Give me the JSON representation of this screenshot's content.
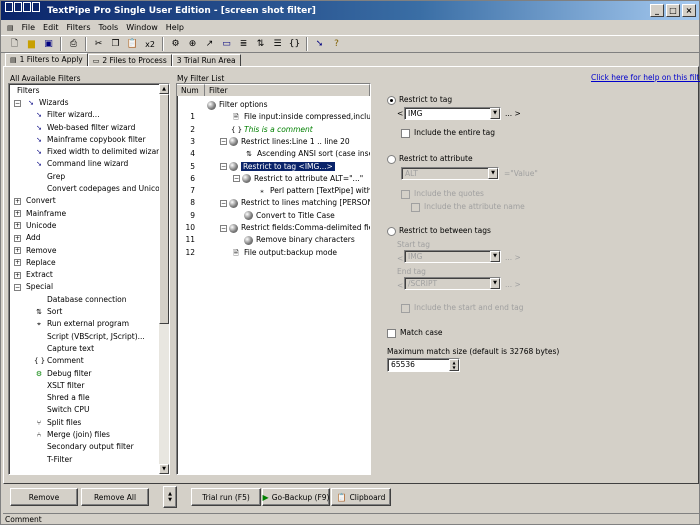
{
  "window": {
    "title": "TextPipe Pro Single User Edition - [screen shot filter]"
  },
  "menu": [
    "File",
    "Edit",
    "Filters",
    "Tools",
    "Window",
    "Help"
  ],
  "toolbar_icons": [
    "new-icon",
    "open-icon",
    "save-icon",
    "print-icon",
    "cut-icon",
    "copy-icon",
    "paste-icon",
    "x2-icon",
    "find-icon",
    "replace-icon",
    "run-icon",
    "filter-icon",
    "list-icon",
    "sort-icon",
    "help-icon"
  ],
  "toolbar_x2": "x2",
  "tabs": [
    {
      "label": "1 Filters to Apply",
      "active": true
    },
    {
      "label": "2 Files to Process",
      "active": false
    },
    {
      "label": "3 Trial Run Area",
      "active": false
    }
  ],
  "left": {
    "title": "All Available Filters",
    "header": "Filters",
    "items": [
      {
        "label": "Wizards",
        "level": 0,
        "expand": "-",
        "icon": "wand-icon"
      },
      {
        "label": "Filter wizard...",
        "level": 2,
        "icon": "wand-icon"
      },
      {
        "label": "Web-based filter wizard",
        "level": 2,
        "icon": "wand-icon"
      },
      {
        "label": "Mainframe copybook filter",
        "level": 2,
        "icon": "wand-icon"
      },
      {
        "label": "Fixed width to delimited wizard",
        "level": 2,
        "icon": "wand-icon"
      },
      {
        "label": "Command line wizard",
        "level": 2,
        "icon": "wand-icon"
      },
      {
        "label": "Grep",
        "level": 1,
        "icon": ""
      },
      {
        "label": "Convert codepages and Unicode...",
        "level": 1,
        "icon": ""
      },
      {
        "label": "Convert",
        "level": 0,
        "expand": "+",
        "icon": ""
      },
      {
        "label": "Mainframe",
        "level": 0,
        "expand": "+",
        "icon": ""
      },
      {
        "label": "Unicode",
        "level": 0,
        "expand": "+",
        "icon": ""
      },
      {
        "label": "Add",
        "level": 0,
        "expand": "+",
        "icon": ""
      },
      {
        "label": "Remove",
        "level": 0,
        "expand": "+",
        "icon": ""
      },
      {
        "label": "Replace",
        "level": 0,
        "expand": "+",
        "icon": ""
      },
      {
        "label": "Extract",
        "level": 0,
        "expand": "+",
        "icon": ""
      },
      {
        "label": "Special",
        "level": 0,
        "expand": "-",
        "icon": ""
      },
      {
        "label": "Database connection",
        "level": 1,
        "icon": ""
      },
      {
        "label": "Sort",
        "level": 1,
        "icon": "sort-icon"
      },
      {
        "label": "Run external program",
        "level": 1,
        "icon": "run-icon"
      },
      {
        "label": "Script (VBScript, JScript)...",
        "level": 1,
        "icon": ""
      },
      {
        "label": "Capture text",
        "level": 1,
        "icon": ""
      },
      {
        "label": "Comment",
        "level": 1,
        "icon": "braces-icon"
      },
      {
        "label": "Debug filter",
        "level": 1,
        "icon": "debug-icon"
      },
      {
        "label": "XSLT filter",
        "level": 1,
        "icon": ""
      },
      {
        "label": "Shred a file",
        "level": 1,
        "icon": ""
      },
      {
        "label": "Switch CPU",
        "level": 1,
        "icon": ""
      },
      {
        "label": "Split files",
        "level": 1,
        "icon": "split-icon"
      },
      {
        "label": "Merge (join) files",
        "level": 1,
        "icon": "merge-icon"
      },
      {
        "label": "Secondary output filter",
        "level": 1,
        "icon": ""
      },
      {
        "label": "T-Filter",
        "level": 1,
        "icon": ""
      }
    ]
  },
  "middle": {
    "title": "My Filter List",
    "col_num": "Num",
    "col_filter": "Filter",
    "rows": [
      {
        "num": "",
        "text": "Filter options",
        "indent": 0,
        "icon": "dot",
        "style": ""
      },
      {
        "num": "1",
        "text": "File input:inside compressed,include ...",
        "indent": 1,
        "icon": "page",
        "style": ""
      },
      {
        "num": "2",
        "text": "This is a comment",
        "indent": 1,
        "icon": "braces",
        "style": "comment"
      },
      {
        "num": "3",
        "text": "Restrict lines:Line 1 .. line 20",
        "indent": 1,
        "icon": "dot",
        "expand": "-",
        "style": ""
      },
      {
        "num": "4",
        "text": "Ascending ANSI sort (case insens:...",
        "indent": 2,
        "icon": "sort",
        "style": ""
      },
      {
        "num": "5",
        "text": "Restrict to tag <IMG...>",
        "indent": 1,
        "icon": "dot",
        "expand": "-",
        "style": "selected"
      },
      {
        "num": "6",
        "text": "Restrict to attribute ALT=\"...\"",
        "indent": 2,
        "icon": "dot",
        "expand": "-",
        "style": ""
      },
      {
        "num": "7",
        "text": "Perl pattern [TextPipe] with [...",
        "indent": 3,
        "icon": "regex",
        "style": ""
      },
      {
        "num": "8",
        "text": "Restrict to lines matching [PERSONREC]",
        "indent": 1,
        "icon": "dot",
        "expand": "-",
        "style": ""
      },
      {
        "num": "9",
        "text": "Convert to Title Case",
        "indent": 2,
        "icon": "dot",
        "style": ""
      },
      {
        "num": "10",
        "text": "Restrict fields:Comma-delimited field ...",
        "indent": 1,
        "icon": "dot",
        "expand": "-",
        "style": ""
      },
      {
        "num": "11",
        "text": "Remove binary characters",
        "indent": 2,
        "icon": "dot",
        "style": ""
      },
      {
        "num": "12",
        "text": "File output:backup mode",
        "indent": 1,
        "icon": "page",
        "style": ""
      }
    ]
  },
  "right": {
    "help_link": "Click here for help on this filter",
    "restrict_tag": {
      "label": "Restrict to tag",
      "selected": true,
      "open": "<",
      "value": "IMG",
      "ellipsis": "...",
      "close": ">",
      "include_entire": "Include the entire tag"
    },
    "restrict_attr": {
      "label": "Restrict to attribute",
      "selected": false,
      "value": "ALT",
      "eq": "=\"Value\"",
      "include_quotes": "Include the quotes",
      "include_name": "Include the attribute name"
    },
    "restrict_between": {
      "label": "Restrict to between tags",
      "selected": false,
      "start_label": "Start tag",
      "start_open": "<",
      "start_value": "IMG",
      "start_ellipsis": "...",
      "start_close": ">",
      "end_label": "End tag",
      "end_open": "<",
      "end_value": "/SCRIPT",
      "end_ellipsis": "...",
      "end_close": ">",
      "include_start_end": "Include the start and end tag"
    },
    "match_case": "Match case",
    "max_match_label": "Maximum match size (default is 32768 bytes)",
    "max_match_value": "65536"
  },
  "buttons": {
    "remove": "Remove",
    "remove_all": "Remove All",
    "trial_run": "Trial run (F5)",
    "go_backup": "Go-Backup (F9)",
    "clipboard": "Clipboard"
  },
  "status": "Comment"
}
